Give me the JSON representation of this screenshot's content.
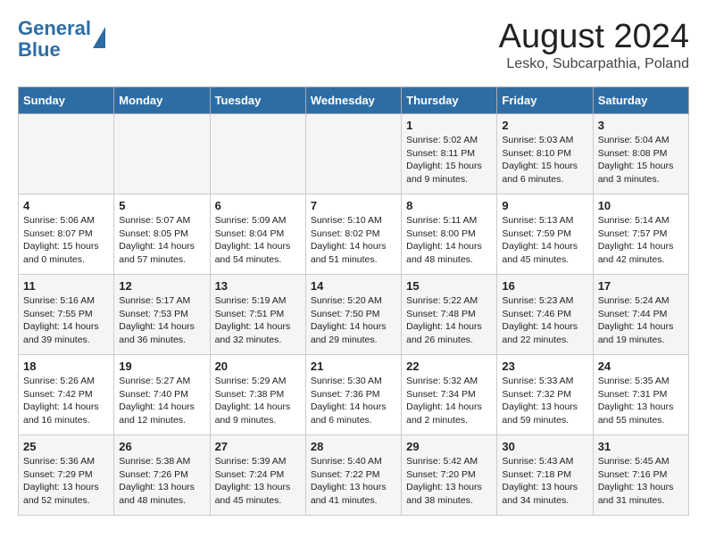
{
  "header": {
    "logo_line1": "General",
    "logo_line2": "Blue",
    "month_title": "August 2024",
    "location": "Lesko, Subcarpathia, Poland"
  },
  "weekdays": [
    "Sunday",
    "Monday",
    "Tuesday",
    "Wednesday",
    "Thursday",
    "Friday",
    "Saturday"
  ],
  "weeks": [
    [
      {
        "day": "",
        "info": ""
      },
      {
        "day": "",
        "info": ""
      },
      {
        "day": "",
        "info": ""
      },
      {
        "day": "",
        "info": ""
      },
      {
        "day": "1",
        "info": "Sunrise: 5:02 AM\nSunset: 8:11 PM\nDaylight: 15 hours\nand 9 minutes."
      },
      {
        "day": "2",
        "info": "Sunrise: 5:03 AM\nSunset: 8:10 PM\nDaylight: 15 hours\nand 6 minutes."
      },
      {
        "day": "3",
        "info": "Sunrise: 5:04 AM\nSunset: 8:08 PM\nDaylight: 15 hours\nand 3 minutes."
      }
    ],
    [
      {
        "day": "4",
        "info": "Sunrise: 5:06 AM\nSunset: 8:07 PM\nDaylight: 15 hours\nand 0 minutes."
      },
      {
        "day": "5",
        "info": "Sunrise: 5:07 AM\nSunset: 8:05 PM\nDaylight: 14 hours\nand 57 minutes."
      },
      {
        "day": "6",
        "info": "Sunrise: 5:09 AM\nSunset: 8:04 PM\nDaylight: 14 hours\nand 54 minutes."
      },
      {
        "day": "7",
        "info": "Sunrise: 5:10 AM\nSunset: 8:02 PM\nDaylight: 14 hours\nand 51 minutes."
      },
      {
        "day": "8",
        "info": "Sunrise: 5:11 AM\nSunset: 8:00 PM\nDaylight: 14 hours\nand 48 minutes."
      },
      {
        "day": "9",
        "info": "Sunrise: 5:13 AM\nSunset: 7:59 PM\nDaylight: 14 hours\nand 45 minutes."
      },
      {
        "day": "10",
        "info": "Sunrise: 5:14 AM\nSunset: 7:57 PM\nDaylight: 14 hours\nand 42 minutes."
      }
    ],
    [
      {
        "day": "11",
        "info": "Sunrise: 5:16 AM\nSunset: 7:55 PM\nDaylight: 14 hours\nand 39 minutes."
      },
      {
        "day": "12",
        "info": "Sunrise: 5:17 AM\nSunset: 7:53 PM\nDaylight: 14 hours\nand 36 minutes."
      },
      {
        "day": "13",
        "info": "Sunrise: 5:19 AM\nSunset: 7:51 PM\nDaylight: 14 hours\nand 32 minutes."
      },
      {
        "day": "14",
        "info": "Sunrise: 5:20 AM\nSunset: 7:50 PM\nDaylight: 14 hours\nand 29 minutes."
      },
      {
        "day": "15",
        "info": "Sunrise: 5:22 AM\nSunset: 7:48 PM\nDaylight: 14 hours\nand 26 minutes."
      },
      {
        "day": "16",
        "info": "Sunrise: 5:23 AM\nSunset: 7:46 PM\nDaylight: 14 hours\nand 22 minutes."
      },
      {
        "day": "17",
        "info": "Sunrise: 5:24 AM\nSunset: 7:44 PM\nDaylight: 14 hours\nand 19 minutes."
      }
    ],
    [
      {
        "day": "18",
        "info": "Sunrise: 5:26 AM\nSunset: 7:42 PM\nDaylight: 14 hours\nand 16 minutes."
      },
      {
        "day": "19",
        "info": "Sunrise: 5:27 AM\nSunset: 7:40 PM\nDaylight: 14 hours\nand 12 minutes."
      },
      {
        "day": "20",
        "info": "Sunrise: 5:29 AM\nSunset: 7:38 PM\nDaylight: 14 hours\nand 9 minutes."
      },
      {
        "day": "21",
        "info": "Sunrise: 5:30 AM\nSunset: 7:36 PM\nDaylight: 14 hours\nand 6 minutes."
      },
      {
        "day": "22",
        "info": "Sunrise: 5:32 AM\nSunset: 7:34 PM\nDaylight: 14 hours\nand 2 minutes."
      },
      {
        "day": "23",
        "info": "Sunrise: 5:33 AM\nSunset: 7:32 PM\nDaylight: 13 hours\nand 59 minutes."
      },
      {
        "day": "24",
        "info": "Sunrise: 5:35 AM\nSunset: 7:31 PM\nDaylight: 13 hours\nand 55 minutes."
      }
    ],
    [
      {
        "day": "25",
        "info": "Sunrise: 5:36 AM\nSunset: 7:29 PM\nDaylight: 13 hours\nand 52 minutes."
      },
      {
        "day": "26",
        "info": "Sunrise: 5:38 AM\nSunset: 7:26 PM\nDaylight: 13 hours\nand 48 minutes."
      },
      {
        "day": "27",
        "info": "Sunrise: 5:39 AM\nSunset: 7:24 PM\nDaylight: 13 hours\nand 45 minutes."
      },
      {
        "day": "28",
        "info": "Sunrise: 5:40 AM\nSunset: 7:22 PM\nDaylight: 13 hours\nand 41 minutes."
      },
      {
        "day": "29",
        "info": "Sunrise: 5:42 AM\nSunset: 7:20 PM\nDaylight: 13 hours\nand 38 minutes."
      },
      {
        "day": "30",
        "info": "Sunrise: 5:43 AM\nSunset: 7:18 PM\nDaylight: 13 hours\nand 34 minutes."
      },
      {
        "day": "31",
        "info": "Sunrise: 5:45 AM\nSunset: 7:16 PM\nDaylight: 13 hours\nand 31 minutes."
      }
    ]
  ]
}
